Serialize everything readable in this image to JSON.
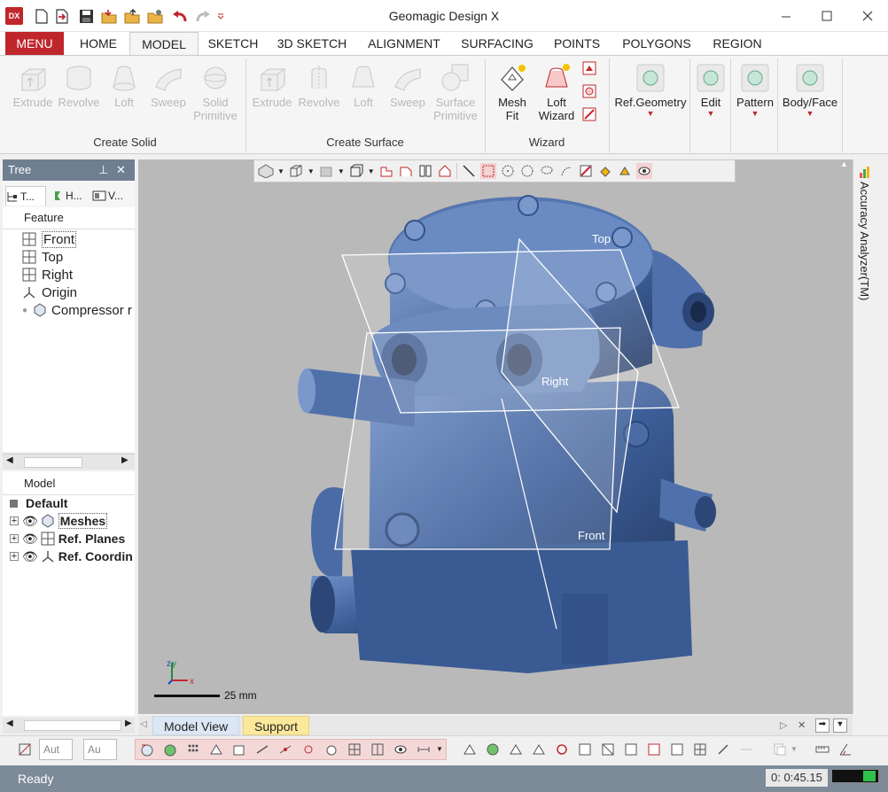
{
  "app": {
    "title": "Geomagic Design X",
    "logo_text": "DX"
  },
  "menu_tabs": [
    "MENU",
    "HOME",
    "MODEL",
    "SKETCH",
    "3D SKETCH",
    "ALIGNMENT",
    "SURFACING",
    "POINTS",
    "POLYGONS",
    "REGION"
  ],
  "active_tab": "MODEL",
  "ribbon": {
    "create_solid": {
      "label": "Create Solid",
      "buttons": [
        "Extrude",
        "Revolve",
        "Loft",
        "Sweep",
        "Solid",
        "Primitive"
      ]
    },
    "create_surface": {
      "label": "Create Surface",
      "buttons": [
        "Extrude",
        "Revolve",
        "Loft",
        "Sweep",
        "Surface",
        "Primitive"
      ]
    },
    "wizard": {
      "label": "Wizard",
      "buttons": [
        "Mesh",
        "Fit",
        "Loft",
        "Wizard"
      ]
    },
    "ref_geometry": "Ref.Geometry",
    "edit": "Edit",
    "pattern": "Pattern",
    "body_face": "Body/Face"
  },
  "tree": {
    "header": "Tree",
    "tabs": [
      "T...",
      "H...",
      "V..."
    ],
    "feature_label": "Feature",
    "items": [
      "Front",
      "Top",
      "Right",
      "Origin",
      "Compressor r"
    ]
  },
  "model_panel": {
    "label": "Model",
    "default_label": "Default",
    "items": [
      "Meshes",
      "Ref. Planes",
      "Ref. Coordin"
    ]
  },
  "viewport": {
    "plane_labels": {
      "top": "Top",
      "right": "Right",
      "front": "Front"
    },
    "scale_label": "25 mm"
  },
  "right_panel": {
    "label": "Accuracy Analyzer(TM)"
  },
  "bottom_tabs": [
    "Model View",
    "Support"
  ],
  "bottom_selects": [
    "Aut",
    "Au"
  ],
  "status": {
    "text": "Ready",
    "timer": "0: 0:45.15"
  },
  "colors": {
    "accent": "#c0272d",
    "mesh": "#3d5f9a",
    "viewport_bg": "#b9b9b9",
    "panel_header": "#6e7f90"
  }
}
